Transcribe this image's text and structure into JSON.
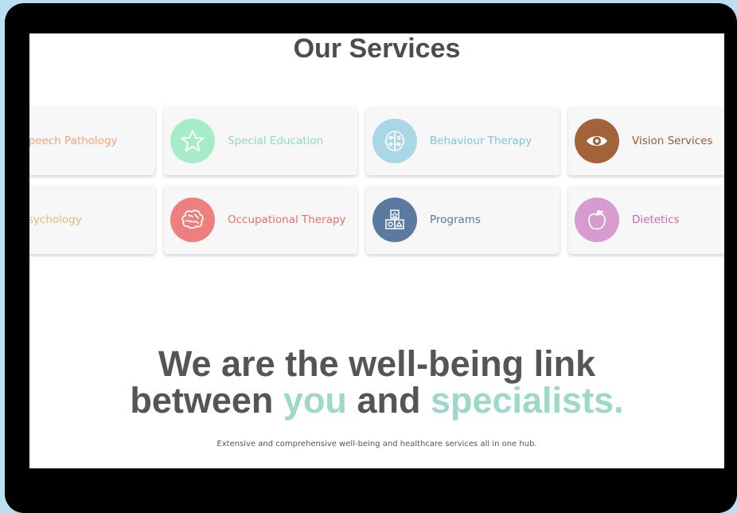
{
  "page": {
    "section_title": "Our Services",
    "headline_line1": "We are the well-being link",
    "headline_line2_a": "between ",
    "headline_line2_accent1": "you",
    "headline_line2_b": " and ",
    "headline_line2_accent2": "specialists.",
    "tagline": "Extensive and comprehensive well-being and healthcare services all in one hub."
  },
  "services": [
    {
      "label": "Speech Pathology",
      "color": "#f0a27a",
      "icon": "none"
    },
    {
      "label": "Special Education",
      "color": "#8fdcb9",
      "icon": "star-icon"
    },
    {
      "label": "Behaviour Therapy",
      "color": "#7fc3df",
      "icon": "brain-chip-icon"
    },
    {
      "label": "Vision Services",
      "color": "#a4623a",
      "icon": "eye-icon"
    },
    {
      "label": "Psychology",
      "color": "#d8bd72",
      "icon": "none"
    },
    {
      "label": "Occupational Therapy",
      "color": "#ea6f6f",
      "icon": "brain-icon"
    },
    {
      "label": "Programs",
      "color": "#5b7aa0",
      "icon": "blocks-icon"
    },
    {
      "label": "Dietetics",
      "color": "#c466b0",
      "icon": "apple-icon"
    }
  ],
  "colors": {
    "accent": "#9ed8c8",
    "heading": "#555555",
    "outer_background": "#b9dff1",
    "frame": "#000000"
  }
}
